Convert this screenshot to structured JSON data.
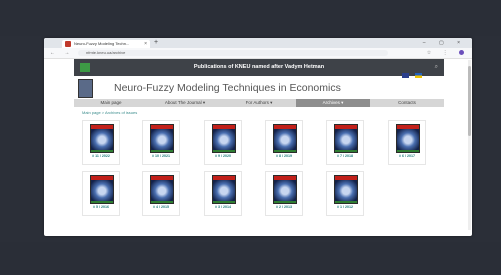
{
  "browser": {
    "tab_title": "Neuro-Fuzzy Modeling Techn...",
    "tab_close": "×",
    "new_tab": "+",
    "window_controls": "– ▢ ×",
    "nav_buttons": "← → ⟳",
    "url": "nfmte.kneu.ua/archive",
    "toolbar_icons": "☆ ⋮"
  },
  "site": {
    "publisher_title": "Publications of KNEU named after Vadym Hetman",
    "search_icon": "⌕",
    "journal_title": "Neuro-Fuzzy Modeling Techniques in Economics"
  },
  "nav": {
    "items": [
      {
        "label": "Main page"
      },
      {
        "label": "About The Journal ▾"
      },
      {
        "label": "For Authors ▾"
      },
      {
        "label": "Archives ▾"
      },
      {
        "label": "Contacts"
      }
    ],
    "active_index": 3
  },
  "breadcrumb": "Main page  >  Archives of issues",
  "issues": [
    {
      "label": "# 11 / 2022"
    },
    {
      "label": "# 10 / 2021"
    },
    {
      "label": "# 9 / 2020"
    },
    {
      "label": "# 8 / 2019"
    },
    {
      "label": "# 7 / 2018"
    },
    {
      "label": "# 6 / 2017"
    },
    {
      "label": "# 5 / 2016"
    },
    {
      "label": "# 4 / 2015"
    },
    {
      "label": "# 3 / 2014"
    },
    {
      "label": "# 2 / 2013"
    },
    {
      "label": "# 1 / 2012"
    }
  ],
  "colors": {
    "header_bg": "#3e4248",
    "active_nav": "#8e8e8e",
    "link": "#1e7d7d"
  }
}
